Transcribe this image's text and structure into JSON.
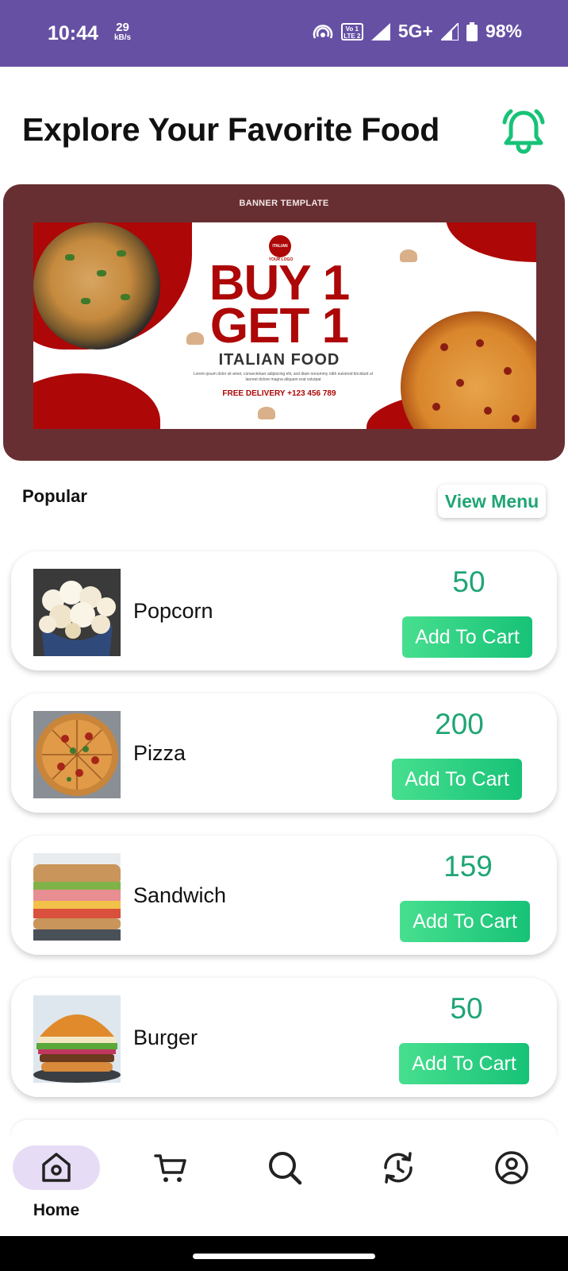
{
  "status_bar": {
    "time": "10:44",
    "speed_value": "29",
    "speed_unit": "kB/s",
    "volte_top": "Vo 1",
    "volte_bottom": "LTE 2",
    "network": "5G+",
    "battery": "98%",
    "icons": [
      "hotspot-icon",
      "volte-icon",
      "signal-icon",
      "signal-icon",
      "battery-icon"
    ]
  },
  "header": {
    "title": "Explore Your Favorite Food",
    "notification_icon": "bell-icon"
  },
  "banner": {
    "caption": "BANNER TEMPLATE",
    "logo_text": "ITALIAN",
    "logo_caption": "YOUR LOGO",
    "headline_line1": "BUY 1",
    "headline_line2": "GET 1",
    "subtitle": "ITALIAN FOOD",
    "body_text": "Lorem ipsum dolor sit amet, consectetuer adipiscing elit, sed diam nonummy nibh euismod tincidunt ut laoreet dolore magna aliquam erat volutpat",
    "delivery": "FREE DELIVERY +123 456 789",
    "colors": {
      "frame": "#682f32",
      "accent": "#ad0707"
    }
  },
  "popular": {
    "title": "Popular",
    "view_menu_label": "View Menu",
    "items": [
      {
        "name": "Popcorn",
        "price": "50",
        "button": "Add To Cart"
      },
      {
        "name": "Pizza",
        "price": "200",
        "button": "Add To Cart"
      },
      {
        "name": "Sandwich",
        "price": "159",
        "button": "Add To Cart"
      },
      {
        "name": "Burger",
        "price": "50",
        "button": "Add To Cart"
      }
    ],
    "accent_color": "#1fa574"
  },
  "bottom_nav": {
    "items": [
      {
        "icon": "home-icon",
        "label": "Home",
        "active": true
      },
      {
        "icon": "cart-icon",
        "label": "",
        "active": false
      },
      {
        "icon": "search-icon",
        "label": "",
        "active": false
      },
      {
        "icon": "history-icon",
        "label": "",
        "active": false
      },
      {
        "icon": "profile-icon",
        "label": "",
        "active": false
      }
    ],
    "active_color": "#e7dcf5"
  }
}
